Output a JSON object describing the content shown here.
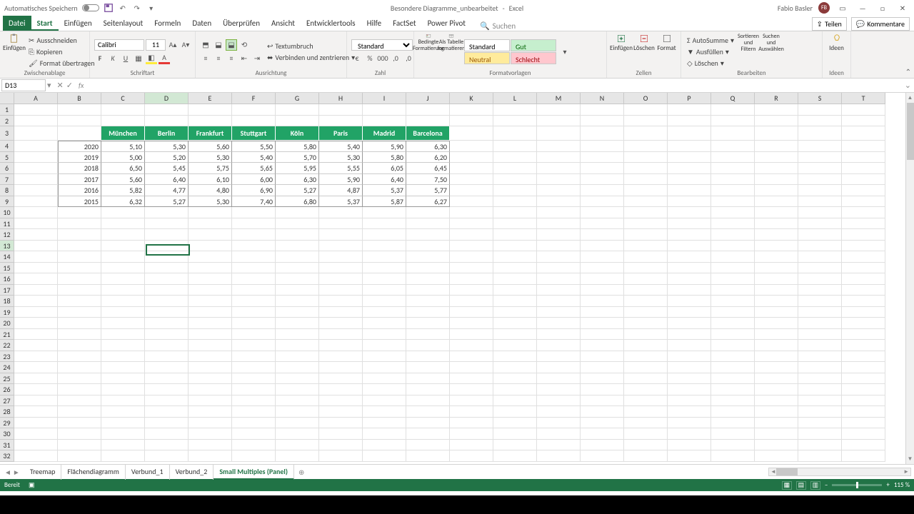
{
  "title": {
    "autosave": "Automatisches Speichern",
    "docname": "Besondere Diagramme_unbearbeitet",
    "app": "Excel",
    "user": "Fabio Basler"
  },
  "tabs": {
    "file": "Datei",
    "items": [
      "Start",
      "Einfügen",
      "Seitenlayout",
      "Formeln",
      "Daten",
      "Überprüfen",
      "Ansicht",
      "Entwicklertools",
      "Hilfe",
      "FactSet",
      "Power Pivot"
    ],
    "active": "Start",
    "search": "Suchen",
    "share": "Teilen",
    "comments": "Kommentare"
  },
  "ribbon": {
    "clipboard": {
      "label": "Zwischenablage",
      "paste": "Einfügen",
      "cut": "Ausschneiden",
      "copy": "Kopieren",
      "format": "Format übertragen"
    },
    "font": {
      "label": "Schriftart",
      "name": "Calibri",
      "size": "11"
    },
    "align": {
      "label": "Ausrichtung",
      "wrap": "Textumbruch",
      "merge": "Verbinden und zentrieren"
    },
    "number": {
      "label": "Zahl",
      "format": "Standard"
    },
    "styles": {
      "label": "Formatvorlagen",
      "cond": "Bedingte Formatierung",
      "table": "Als Tabelle formatieren",
      "standard": "Standard",
      "gut": "Gut",
      "neutral": "Neutral",
      "schlecht": "Schlecht"
    },
    "cells": {
      "label": "Zellen",
      "insert": "Einfügen",
      "delete": "Löschen",
      "format": "Format"
    },
    "editing": {
      "label": "Bearbeiten",
      "autosum": "AutoSumme",
      "fill": "Ausfüllen",
      "clear": "Löschen",
      "sort": "Sortieren und Filtern",
      "find": "Suchen und Auswählen"
    },
    "ideas": {
      "label": "Ideen",
      "btn": "Ideen"
    }
  },
  "namebox": "D13",
  "cols": [
    "A",
    "B",
    "C",
    "D",
    "E",
    "F",
    "G",
    "H",
    "I",
    "J",
    "K",
    "L",
    "M",
    "N",
    "O",
    "P",
    "Q",
    "R",
    "S",
    "T"
  ],
  "headers": [
    "München",
    "Berlin",
    "Frankfurt",
    "Stuttgart",
    "Köln",
    "Paris",
    "Madrid",
    "Barcelona"
  ],
  "rows": [
    {
      "y": "2020",
      "v": [
        "5,10",
        "5,30",
        "5,60",
        "5,50",
        "5,80",
        "5,40",
        "5,90",
        "6,30"
      ]
    },
    {
      "y": "2019",
      "v": [
        "5,00",
        "5,20",
        "5,30",
        "5,40",
        "5,70",
        "5,30",
        "5,80",
        "6,20"
      ]
    },
    {
      "y": "2018",
      "v": [
        "6,50",
        "5,45",
        "5,75",
        "5,65",
        "5,95",
        "5,55",
        "6,05",
        "6,45"
      ]
    },
    {
      "y": "2017",
      "v": [
        "5,60",
        "6,40",
        "6,10",
        "6,00",
        "6,30",
        "5,90",
        "6,40",
        "7,50"
      ]
    },
    {
      "y": "2016",
      "v": [
        "5,82",
        "4,77",
        "4,80",
        "6,90",
        "5,27",
        "4,87",
        "5,37",
        "5,77"
      ]
    },
    {
      "y": "2015",
      "v": [
        "6,32",
        "5,27",
        "5,30",
        "7,40",
        "6,80",
        "5,37",
        "5,87",
        "6,27"
      ]
    }
  ],
  "sheets": {
    "items": [
      "Treemap",
      "Flächendiagramm",
      "Verbund_1",
      "Verbund_2",
      "Small Multiples (Panel)"
    ],
    "active": "Small Multiples (Panel)"
  },
  "status": {
    "ready": "Bereit",
    "zoom": "115 %"
  }
}
